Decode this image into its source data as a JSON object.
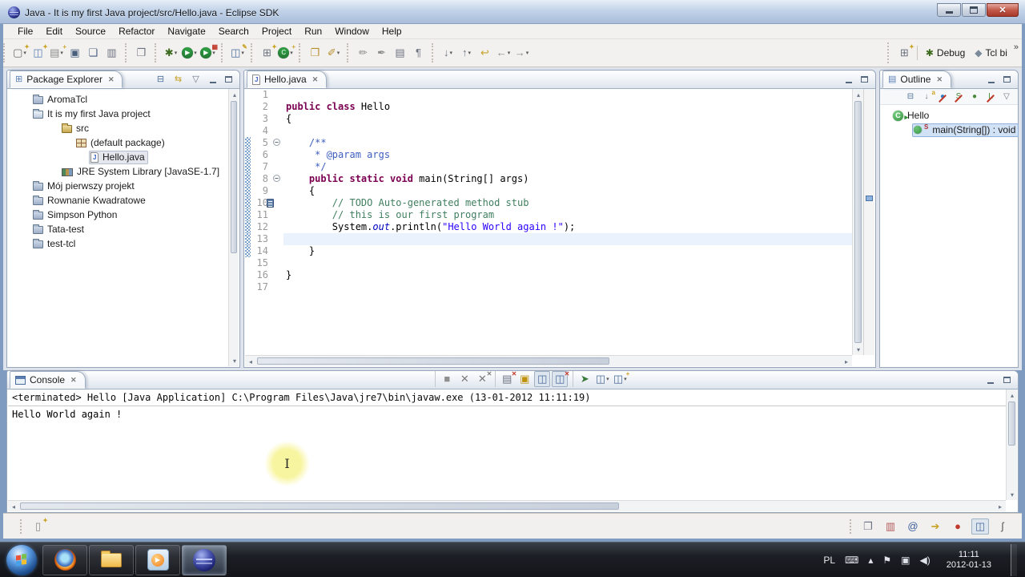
{
  "colors": {
    "keyword": "#7b0052",
    "string": "#2a00ff",
    "comment": "#3f7f5f",
    "javadoc": "#3f5fbf",
    "static_field": "#0000c0",
    "current_line": "#e9f2fd",
    "selection": "#d2e2f6"
  },
  "window": {
    "title": "Java - It is my first Java project/src/Hello.java - Eclipse SDK"
  },
  "menubar": [
    "File",
    "Edit",
    "Source",
    "Refactor",
    "Navigate",
    "Search",
    "Project",
    "Run",
    "Window",
    "Help"
  ],
  "toolbar": {
    "groups": [
      [
        {
          "name": "new-wizard",
          "glyph": "▢",
          "color": "#6b6b6b",
          "badge": "✦",
          "dd": true
        },
        {
          "name": "open-file",
          "glyph": "◫",
          "color": "#5b7fb4",
          "badge": "✦"
        },
        {
          "name": "new-untitled-file",
          "glyph": "▤",
          "color": "#8a8a8a",
          "badge": "+",
          "dd": true
        },
        {
          "name": "save",
          "glyph": "▣",
          "color": "#4a5e7e"
        },
        {
          "name": "save-all",
          "glyph": "❏",
          "color": "#4a5e7e"
        },
        {
          "name": "print",
          "glyph": "▥",
          "color": "#6b7280"
        }
      ],
      [
        {
          "name": "compare",
          "glyph": "❐",
          "color": "#6b7280"
        }
      ],
      [
        {
          "name": "debug",
          "glyph": "✱",
          "color": "#3d6b1e",
          "dd": true
        },
        {
          "name": "run",
          "glyph": "▶",
          "circle": "#2f9e44",
          "dd": true
        },
        {
          "name": "run-external-tools",
          "glyph": "▶",
          "circle": "#2f9e44",
          "badge": "▦",
          "badgeColor": "#c0392b",
          "dd": true
        }
      ],
      [
        {
          "name": "open-java-element",
          "glyph": "◫",
          "color": "#4a6c9b",
          "badge": "✎",
          "dd": true
        }
      ],
      [
        {
          "name": "new-java-project",
          "glyph": "⊞",
          "color": "#6b7280",
          "badge": "✦"
        },
        {
          "name": "new-java-class",
          "glyph": "C",
          "circle": "#2f9e44",
          "badge": "+",
          "dd": true
        }
      ],
      [
        {
          "name": "open-type",
          "glyph": "❐",
          "color": "#b8902c"
        },
        {
          "name": "search",
          "glyph": "✐",
          "color": "#b8902c",
          "dd": true
        }
      ],
      [
        {
          "name": "toggle-mark-occurrences",
          "glyph": "✏",
          "color": "#8a8a8a"
        },
        {
          "name": "toggle-block-selection",
          "glyph": "✒",
          "color": "#8a8a8a"
        },
        {
          "name": "show-source-of-selected-element",
          "glyph": "▤",
          "color": "#6b7280"
        },
        {
          "name": "show-whitespace",
          "glyph": "¶",
          "color": "#6b7280"
        }
      ],
      [
        {
          "name": "next-annotation",
          "glyph": "↓",
          "color": "#6b7280",
          "dd": true
        },
        {
          "name": "previous-annotation",
          "glyph": "↑",
          "color": "#6b7280",
          "dd": true
        },
        {
          "name": "last-edit-location",
          "glyph": "↩",
          "color": "#c9a227"
        },
        {
          "name": "back-history",
          "glyph": "←",
          "color": "#8a8a8a",
          "dd": true
        },
        {
          "name": "forward-history",
          "glyph": "→",
          "color": "#8a8a8a",
          "dd": true
        }
      ]
    ],
    "perspectives": {
      "open_button": {
        "name": "open-perspective",
        "glyph": "⊞",
        "color": "#6b7280",
        "badge": "✦"
      },
      "items": [
        {
          "name": "debug-perspective",
          "glyph": "✱",
          "color": "#3d6b1e",
          "label": "Debug"
        },
        {
          "name": "tcl-perspective",
          "glyph": "◆",
          "color": "#7a8a9a",
          "label": "Tcl bi"
        }
      ],
      "chevron": "»"
    }
  },
  "package_explorer": {
    "tab_label": "Package Explorer",
    "toolbar": [
      {
        "name": "collapse-all",
        "glyph": "⊟",
        "color": "#4a6c9b"
      },
      {
        "name": "link-with-editor",
        "glyph": "⇆",
        "color": "#c9a227"
      },
      {
        "name": "view-menu",
        "glyph": "▽",
        "color": "#6b7280"
      }
    ],
    "items": [
      {
        "label": "AromaTcl",
        "icon": "folder",
        "level": 0
      },
      {
        "label": "It is my first Java project",
        "icon": "folder-open",
        "level": 0
      },
      {
        "label": "src",
        "icon": "src",
        "level": 2
      },
      {
        "label": "(default package)",
        "icon": "package",
        "level": 3
      },
      {
        "label": "Hello.java",
        "icon": "java-file",
        "level": 4,
        "selected": true
      },
      {
        "label": "JRE System Library [JavaSE-1.7]",
        "icon": "library",
        "level": 2
      },
      {
        "label": "Mój pierwszy projekt",
        "icon": "folder",
        "level": 0
      },
      {
        "label": "Rownanie Kwadratowe",
        "icon": "folder",
        "level": 0
      },
      {
        "label": "Simpson Python",
        "icon": "folder",
        "level": 0
      },
      {
        "label": "Tata-test",
        "icon": "folder",
        "level": 0
      },
      {
        "label": "test-tcl",
        "icon": "folder",
        "level": 0
      }
    ]
  },
  "editor": {
    "tab_label": "Hello.java",
    "range_indicator": [
      5,
      14
    ],
    "fold_lines": [
      5,
      8
    ],
    "task_line": 10,
    "current_line": 13,
    "lines": [
      {
        "n": 1,
        "segs": []
      },
      {
        "n": 2,
        "segs": [
          {
            "t": "public class",
            "s": "kw"
          },
          {
            "t": " Hello",
            "s": "pl"
          }
        ]
      },
      {
        "n": 3,
        "segs": [
          {
            "t": "{",
            "s": "pl"
          }
        ]
      },
      {
        "n": 4,
        "segs": []
      },
      {
        "n": 5,
        "segs": [
          {
            "t": "    ",
            "s": "pl"
          },
          {
            "t": "/**",
            "s": "jd"
          }
        ]
      },
      {
        "n": 6,
        "segs": [
          {
            "t": "     ",
            "s": "pl"
          },
          {
            "t": "* @param args",
            "s": "jd"
          }
        ]
      },
      {
        "n": 7,
        "segs": [
          {
            "t": "     ",
            "s": "pl"
          },
          {
            "t": "*/",
            "s": "jd"
          }
        ]
      },
      {
        "n": 8,
        "segs": [
          {
            "t": "    ",
            "s": "pl"
          },
          {
            "t": "public static void",
            "s": "kw"
          },
          {
            "t": " main(String[] args)",
            "s": "pl"
          }
        ]
      },
      {
        "n": 9,
        "segs": [
          {
            "t": "    {",
            "s": "pl"
          }
        ]
      },
      {
        "n": 10,
        "segs": [
          {
            "t": "        ",
            "s": "pl"
          },
          {
            "t": "// TODO Auto-generated method stub",
            "s": "cm"
          }
        ]
      },
      {
        "n": 11,
        "segs": [
          {
            "t": "        ",
            "s": "pl"
          },
          {
            "t": "// this is our first program",
            "s": "cm"
          }
        ]
      },
      {
        "n": 12,
        "segs": [
          {
            "t": "        System.",
            "s": "pl"
          },
          {
            "t": "out",
            "s": "fd"
          },
          {
            "t": ".println(",
            "s": "pl"
          },
          {
            "t": "\"Hello World again !\"",
            "s": "st"
          },
          {
            "t": ");",
            "s": "pl"
          }
        ]
      },
      {
        "n": 13,
        "segs": []
      },
      {
        "n": 14,
        "segs": [
          {
            "t": "    }",
            "s": "pl"
          }
        ]
      },
      {
        "n": 15,
        "segs": []
      },
      {
        "n": 16,
        "segs": [
          {
            "t": "}",
            "s": "pl"
          }
        ]
      },
      {
        "n": 17,
        "segs": []
      }
    ]
  },
  "outline": {
    "tab_label": "Outline",
    "toolbar": [
      {
        "name": "collapse-all",
        "glyph": "⊟",
        "color": "#4a6c9b"
      },
      {
        "name": "sort",
        "glyph": "↓",
        "color": "#6b7280",
        "badge": "a"
      },
      {
        "name": "hide-fields",
        "glyph": "●",
        "color": "#2f7ec4",
        "slash": true
      },
      {
        "name": "hide-static-members",
        "glyph": "S",
        "color": "#4a8a3a",
        "slash": true
      },
      {
        "name": "hide-non-public-members",
        "glyph": "●",
        "color": "#4a8a3a"
      },
      {
        "name": "hide-local-types",
        "glyph": "L",
        "color": "#4a8a3a",
        "slash": true
      },
      {
        "name": "view-menu",
        "glyph": "▽",
        "color": "#6b7280"
      }
    ],
    "items": [
      {
        "label": "Hello",
        "icon": "class",
        "level": 0
      },
      {
        "label": "main(String[]) : void",
        "icon": "method-static",
        "level": 1,
        "selected": true
      }
    ]
  },
  "console": {
    "tab_label": "Console",
    "header": "<terminated> Hello [Java Application] C:\\Program Files\\Java\\jre7\\bin\\javaw.exe (13-01-2012 11:11:19)",
    "output": "Hello World again !",
    "toolbar": [
      [
        {
          "name": "terminate",
          "glyph": "■",
          "color": "#909090"
        },
        {
          "name": "remove-launch",
          "glyph": "✕",
          "color": "#7a7a7a"
        },
        {
          "name": "remove-all-terminated",
          "glyph": "✕",
          "color": "#7a7a7a",
          "badge": "✕",
          "badgeColor": "#7a7a7a"
        }
      ],
      [
        {
          "name": "clear-console",
          "glyph": "▤",
          "color": "#6b7280",
          "badge": "✕",
          "badgeColor": "#c0392b"
        },
        {
          "name": "scroll-lock",
          "glyph": "▣",
          "color": "#c0920c"
        },
        {
          "name": "show-stdout-when-changed",
          "glyph": "◫",
          "color": "#4a6c9b",
          "pressed": true
        },
        {
          "name": "show-stderr-when-changed",
          "glyph": "◫",
          "color": "#4a6c9b",
          "badge": "✕",
          "badgeColor": "#c0392b",
          "pressed": true
        }
      ],
      [
        {
          "name": "pin-console",
          "glyph": "➤",
          "color": "#3a7a3a"
        },
        {
          "name": "display-selected-console",
          "glyph": "◫",
          "color": "#4a6c9b",
          "dd": true
        },
        {
          "name": "open-console",
          "glyph": "◫",
          "color": "#4a6c9b",
          "badge": "+",
          "dd": true
        }
      ]
    ]
  },
  "statusbar": {
    "left_icon": {
      "name": "new-shortcut",
      "glyph": "▯",
      "color": "#8a8a8a",
      "badge": "✦"
    },
    "right_icons": [
      {
        "name": "fast-view",
        "glyph": "❐",
        "color": "#6b7280"
      },
      {
        "name": "cheat-sheet",
        "glyph": "▥",
        "color": "#b05a5a"
      },
      {
        "name": "mail",
        "glyph": "@",
        "color": "#3a5a9a"
      },
      {
        "name": "export-tip",
        "glyph": "➔",
        "color": "#c9a227"
      },
      {
        "name": "error-log",
        "glyph": "●",
        "color": "#c0392b"
      },
      {
        "name": "console-view",
        "glyph": "◫",
        "color": "#4a6c9b",
        "pressed": true
      },
      {
        "name": "java-scrapbook",
        "glyph": "ʃ",
        "color": "#555555"
      }
    ]
  },
  "taskbar": {
    "apps": [
      "firefox",
      "explorer",
      "media-player",
      "eclipse"
    ],
    "active_app": "eclipse",
    "tray_icons": [
      {
        "name": "keyboard",
        "glyph": "⌨"
      },
      {
        "name": "show-hidden-icons",
        "glyph": "▴"
      },
      {
        "name": "action-center",
        "glyph": "⚑"
      },
      {
        "name": "network",
        "glyph": "▣"
      },
      {
        "name": "volume",
        "glyph": "◀)"
      }
    ],
    "lang": "PL",
    "time": "11:11",
    "date": "2012-01-13"
  }
}
